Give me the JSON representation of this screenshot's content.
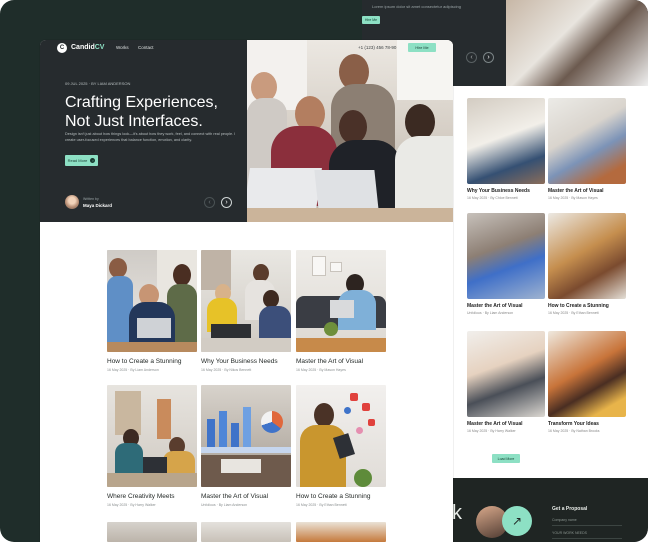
{
  "nav": {
    "logo_mark": "C",
    "logo_text": "Candid",
    "logo_accent": "CV",
    "links": [
      "Works",
      "Contact"
    ],
    "phone": "+1 (123) 456 78-90",
    "cta": "Hire Me"
  },
  "hero": {
    "meta": "09 JUL 2025  ·  BY LIAM ANDERSON",
    "title_line1": "Crafting Experiences,",
    "title_line2": "Not Just Interfaces.",
    "description": "Design isn't just about how things look—it's about how they work, feel, and connect with real people. I create user-focused experiences that balance function, emotion, and clarity.",
    "button": "Read More",
    "button_icon": "arrow-right-icon",
    "written_by": "Written by",
    "author": "Maya Dickard",
    "prev_icon": "‹",
    "next_icon": "›"
  },
  "grid": [
    {
      "title": "How to Create a Stunning",
      "date": "16 May 2025",
      "author": "By Liam Anderson"
    },
    {
      "title": "Why Your Business Needs",
      "date": "16 May 2025",
      "author": "By Nikos Bennett"
    },
    {
      "title": "Master the Art of Visual",
      "date": "16 May 2025",
      "author": "By Mason Hayes"
    },
    {
      "title": "Where Creativity Meets",
      "date": "16 May 2025",
      "author": "By Harry Walker"
    },
    {
      "title": "Master the Art of Visual",
      "date": "Unfolious",
      "author": "By Liam Anderson"
    },
    {
      "title": "How to Create a Stunning",
      "date": "16 May 2025",
      "author": "By Ethan Bennett"
    }
  ],
  "back": {
    "top_text": "Lorem ipsum dolor sit amet consectetur adipiscing",
    "top_button": "Hire Me",
    "cards": [
      {
        "title": "Why Your Business Needs",
        "meta": "16 May 2025  ·  By Chloe Bennett"
      },
      {
        "title": "Master the Art of Visual",
        "meta": "16 May 2025  ·  By Mason Hayes"
      },
      {
        "title": "Master the Art of Visual",
        "meta": "Unfolious  ·  By Liam Anderson"
      },
      {
        "title": "How to Create a Stunning",
        "meta": "16 May 2025  ·  By Ethan Bennett"
      },
      {
        "title": "Master the Art of Visual",
        "meta": "16 May 2025  ·  By Harry Walker"
      },
      {
        "title": "Transform Your Ideas",
        "meta": "16 May 2025  ·  By Nathan Brooks"
      }
    ],
    "load_more": "Load More",
    "footer_big": "k",
    "footer_heading": "Get a Proposal",
    "footer_lines": [
      "Company name",
      "YOUR WORK NEEDS"
    ]
  },
  "colors": {
    "accent": "#8de0c4",
    "dark": "#262b2e"
  }
}
